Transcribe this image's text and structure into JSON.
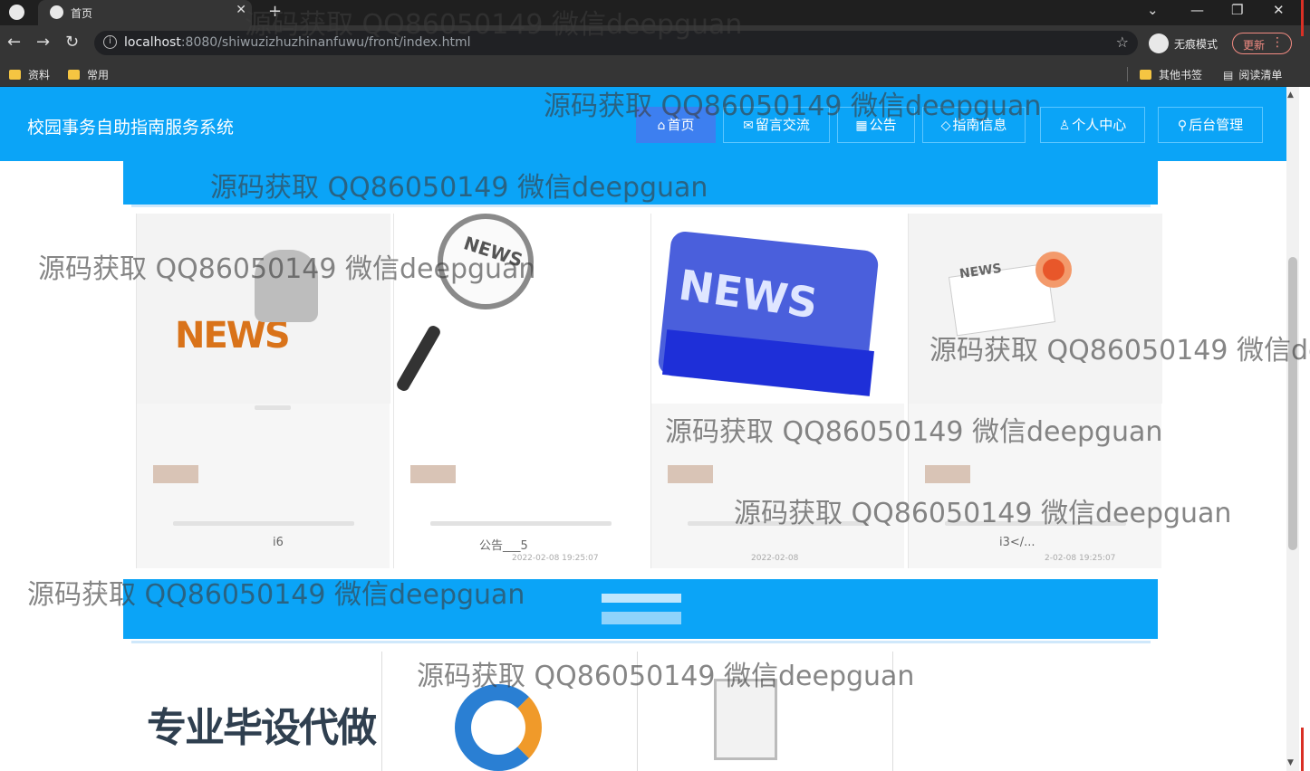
{
  "browser": {
    "tab_title": "首页",
    "new_tab": "+",
    "url_host": "localhost",
    "url_rest": ":8080/shiwuzizhuzhinanfuwu/front/index.html",
    "incognito_label": "无痕模式",
    "update_label": "更新",
    "bookmarks": [
      "资料",
      "常用"
    ],
    "bookmarks_right": [
      "其他书签",
      "阅读清单"
    ]
  },
  "site": {
    "title": "校园事务自助指南服务系统",
    "nav": [
      {
        "label": "首页",
        "icon": "home-icon",
        "active": true
      },
      {
        "label": "留言交流",
        "icon": "mail-icon",
        "active": false
      },
      {
        "label": "公告",
        "icon": "grid-icon",
        "active": false
      },
      {
        "label": "指南信息",
        "icon": "tag-icon",
        "active": false
      },
      {
        "label": "个人中心",
        "icon": "user-icon",
        "active": false
      },
      {
        "label": "后台管理",
        "icon": "link-icon",
        "active": false
      }
    ]
  },
  "news": {
    "cards": [
      {
        "image_text": "NEWS",
        "title": "i6",
        "date": ""
      },
      {
        "image_text": "NEWS",
        "title": "公告___5",
        "date": "2022-02-08 19:25:07"
      },
      {
        "image_text": "NEWS",
        "title": "",
        "date": "2022-02-08"
      },
      {
        "image_text": "NEWS",
        "title": "i3</...",
        "date": "2-02-08 19:25:07"
      }
    ]
  },
  "bottom": {
    "banner_text": "专业毕设代做"
  },
  "watermark_text": "源码获取 QQ86050149 微信deepguan",
  "colors": {
    "header_blue": "#0ba4f7",
    "nav_active": "#3d7ff0",
    "chrome_dark": "#353535"
  }
}
